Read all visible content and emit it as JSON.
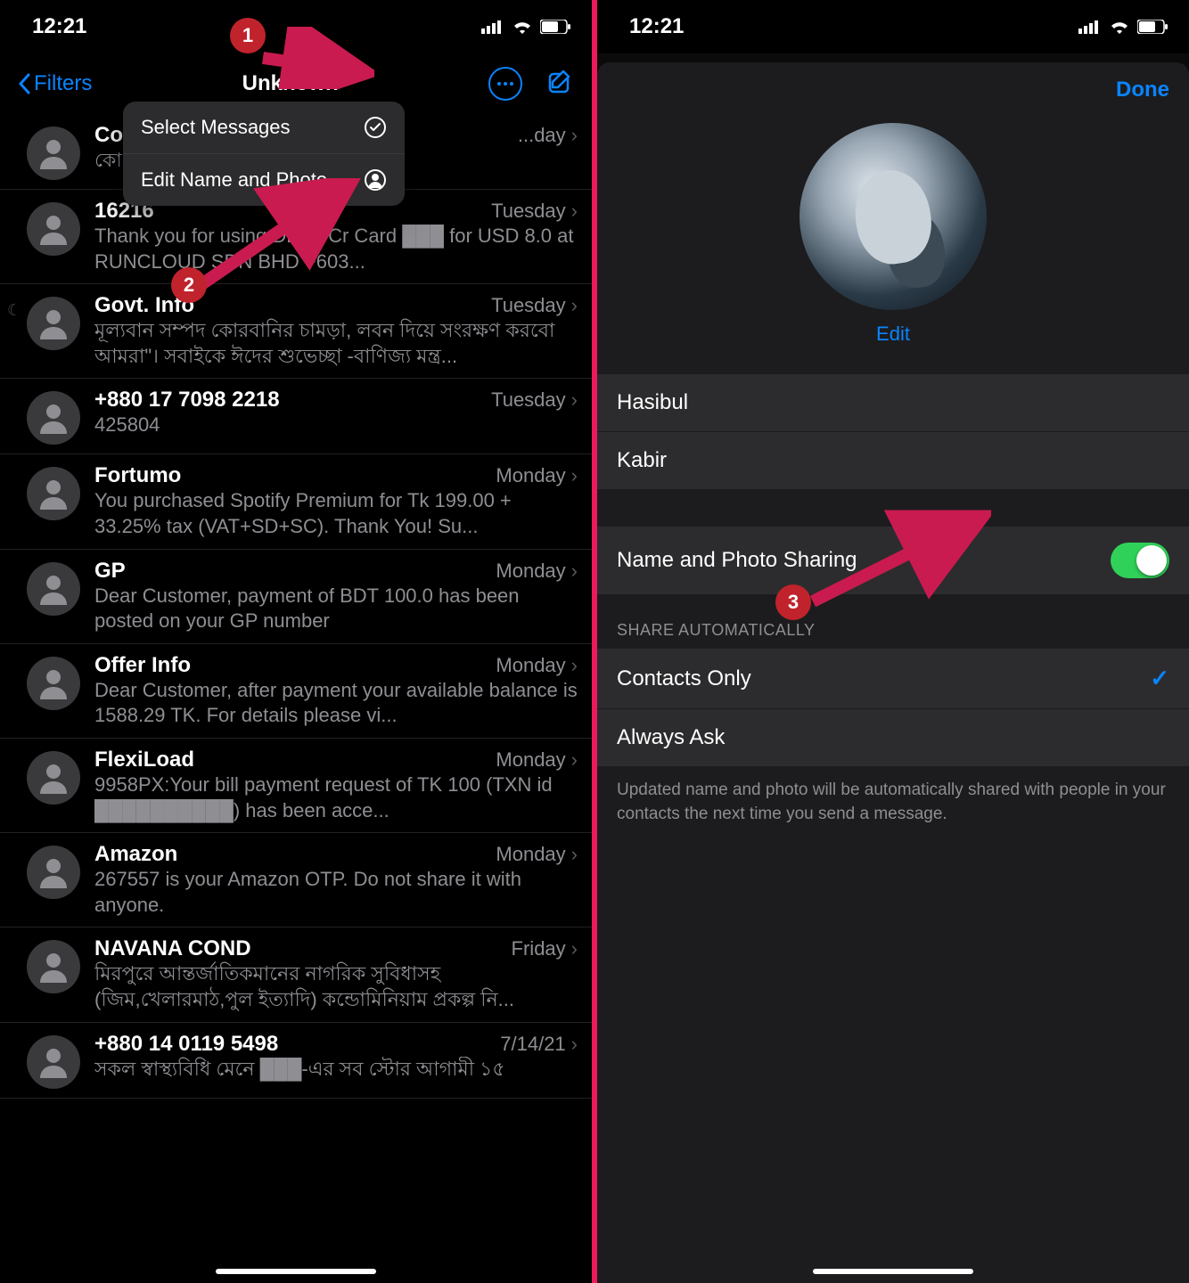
{
  "status": {
    "time": "12:21"
  },
  "left": {
    "back": "Filters",
    "title": "Unknown",
    "popover": {
      "item1": "Select Messages",
      "item2": "Edit Name and Photo"
    },
    "messages": [
      {
        "sender": "Co...",
        "date": "...day",
        "preview": "কো...\nকো..."
      },
      {
        "sender": "16216",
        "date": "Tuesday",
        "preview": "Thank you for using DBBL Cr Card ███ for USD 8.0 at RUNCLOUD SDN BHD +603..."
      },
      {
        "sender": "Govt. Info",
        "date": "Tuesday",
        "preview": "মূল্যবান সম্পদ কোরবানির চামড়া, লবন দিয়ে সংরক্ষণ করবো আমরা\"। সবাইকে ঈদের শুভেচ্ছা -বাণিজ্য মন্ত্র..."
      },
      {
        "sender": "+880 17 7098 2218",
        "date": "Tuesday",
        "preview": "425804"
      },
      {
        "sender": "Fortumo",
        "date": "Monday",
        "preview": "You purchased Spotify Premium for Tk 199.00 + 33.25% tax (VAT+SD+SC). Thank You! Su..."
      },
      {
        "sender": "GP",
        "date": "Monday",
        "preview": "Dear Customer, payment of BDT 100.0 has been posted on your GP number"
      },
      {
        "sender": "Offer Info",
        "date": "Monday",
        "preview": "Dear Customer, after payment your available balance is 1588.29 TK. For details please vi..."
      },
      {
        "sender": "FlexiLoad",
        "date": "Monday",
        "preview": "9958PX:Your bill payment request of TK 100 (TXN id ██████████) has been acce..."
      },
      {
        "sender": "Amazon",
        "date": "Monday",
        "preview": "267557 is your Amazon OTP. Do not share it with anyone."
      },
      {
        "sender": "NAVANA COND",
        "date": "Friday",
        "preview": "মিরপুরে আন্তর্জাতিকমানের নাগরিক সুবিধাসহ (জিম,খেলারমাঠ,পুল ইত্যাদি) কন্ডোমিনিয়াম প্রকল্প নি..."
      },
      {
        "sender": "+880 14 0119 5498",
        "date": "7/14/21",
        "preview": "সকল স্বাস্থ্যবিধি মেনে ███-এর সব স্টোর আগামী ১৫"
      }
    ]
  },
  "right": {
    "done": "Done",
    "edit": "Edit",
    "first_name": "Hasibul",
    "last_name": "Kabir",
    "sharing_label": "Name and Photo Sharing",
    "section_header": "SHARE AUTOMATICALLY",
    "option1": "Contacts Only",
    "option2": "Always Ask",
    "footer": "Updated name and photo will be automatically shared with people in your contacts the next time you send a message."
  },
  "annotations": {
    "b1": "1",
    "b2": "2",
    "b3": "3"
  }
}
